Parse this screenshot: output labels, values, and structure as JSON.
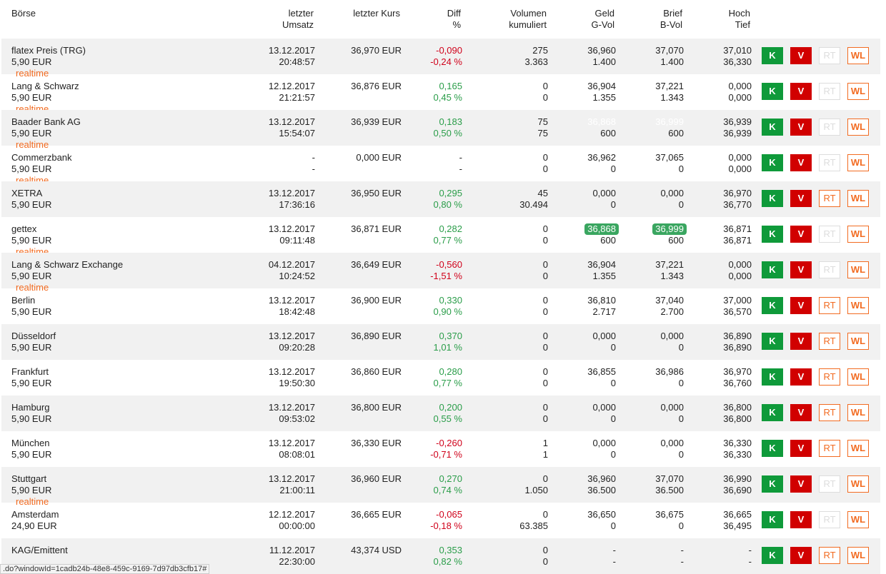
{
  "header": {
    "boerse": "Börse",
    "umsatz": [
      "letzter",
      "Umsatz"
    ],
    "kurs": "letzter Kurs",
    "diff": [
      "Diff",
      "%"
    ],
    "volumen": [
      "Volumen",
      "kumuliert"
    ],
    "geld": [
      "Geld",
      "G-Vol"
    ],
    "brief": [
      "Brief",
      "B-Vol"
    ],
    "hoch": [
      "Hoch",
      "Tief"
    ]
  },
  "buttons": {
    "k": "K",
    "v": "V",
    "rt": "RT",
    "wl": "WL"
  },
  "realtime_label": "realtime",
  "rows": [
    {
      "name": "flatex Preis (TRG)",
      "fee": "5,90 EUR",
      "realtime": true,
      "date": "13.12.2017",
      "time": "20:48:57",
      "kurs": "36,970 EUR",
      "diff": "-0,090",
      "pct": "-0,24 %",
      "dir": "neg",
      "vol": "275",
      "volk": "3.363",
      "geld": "36,960",
      "gvol": "1.400",
      "brief": "37,070",
      "bvol": "1.400",
      "hoch": "37,010",
      "tief": "36,330",
      "rt_active": false
    },
    {
      "name": "Lang & Schwarz",
      "fee": "5,90 EUR",
      "realtime": true,
      "date": "12.12.2017",
      "time": "21:21:57",
      "kurs": "36,876 EUR",
      "diff": "0,165",
      "pct": "0,45 %",
      "dir": "pos",
      "vol": "0",
      "volk": "0",
      "geld": "36,904",
      "gvol": "1.355",
      "brief": "37,221",
      "bvol": "1.343",
      "hoch": "0,000",
      "tief": "0,000",
      "rt_active": false
    },
    {
      "name": "Baader Bank AG",
      "fee": "5,90 EUR",
      "realtime": true,
      "date": "13.12.2017",
      "time": "15:54:07",
      "kurs": "36,939 EUR",
      "diff": "0,183",
      "pct": "0,50 %",
      "dir": "pos",
      "vol": "75",
      "volk": "75",
      "geld": "36,868",
      "gvol": "600",
      "brief": "36,999",
      "bvol": "600",
      "hoch": "36,939",
      "tief": "36,939",
      "rt_active": false,
      "quote_style": "faded"
    },
    {
      "name": "Commerzbank",
      "fee": "5,90 EUR",
      "realtime": true,
      "date": "-",
      "time": "-",
      "kurs": "0,000 EUR",
      "diff": "-",
      "pct": "-",
      "dir": "",
      "vol": "0",
      "volk": "0",
      "geld": "36,962",
      "gvol": "0",
      "brief": "37,065",
      "bvol": "0",
      "hoch": "0,000",
      "tief": "0,000",
      "rt_active": false
    },
    {
      "name": "XETRA",
      "fee": "5,90 EUR",
      "realtime": false,
      "date": "13.12.2017",
      "time": "17:36:16",
      "kurs": "36,950 EUR",
      "diff": "0,295",
      "pct": "0,80 %",
      "dir": "pos",
      "vol": "45",
      "volk": "30.494",
      "geld": "0,000",
      "gvol": "0",
      "brief": "0,000",
      "bvol": "0",
      "hoch": "36,970",
      "tief": "36,770",
      "rt_active": true
    },
    {
      "name": "gettex",
      "fee": "5,90 EUR",
      "realtime": true,
      "date": "13.12.2017",
      "time": "09:11:48",
      "kurs": "36,871 EUR",
      "diff": "0,282",
      "pct": "0,77 %",
      "dir": "pos",
      "vol": "0",
      "volk": "0",
      "geld": "36,868",
      "gvol": "600",
      "brief": "36,999",
      "bvol": "600",
      "hoch": "36,871",
      "tief": "36,871",
      "rt_active": false,
      "quote_style": "badge"
    },
    {
      "name": "Lang & Schwarz Exchange",
      "fee": "5,90 EUR",
      "realtime": true,
      "date": "04.12.2017",
      "time": "10:24:52",
      "kurs": "36,649 EUR",
      "diff": "-0,560",
      "pct": "-1,51 %",
      "dir": "neg",
      "vol": "0",
      "volk": "0",
      "geld": "36,904",
      "gvol": "1.355",
      "brief": "37,221",
      "bvol": "1.343",
      "hoch": "0,000",
      "tief": "0,000",
      "rt_active": false
    },
    {
      "name": "Berlin",
      "fee": "5,90 EUR",
      "realtime": false,
      "date": "13.12.2017",
      "time": "18:42:48",
      "kurs": "36,900 EUR",
      "diff": "0,330",
      "pct": "0,90 %",
      "dir": "pos",
      "vol": "0",
      "volk": "0",
      "geld": "36,810",
      "gvol": "2.717",
      "brief": "37,040",
      "bvol": "2.700",
      "hoch": "37,000",
      "tief": "36,570",
      "rt_active": true
    },
    {
      "name": "Düsseldorf",
      "fee": "5,90 EUR",
      "realtime": false,
      "date": "13.12.2017",
      "time": "09:20:28",
      "kurs": "36,890 EUR",
      "diff": "0,370",
      "pct": "1,01 %",
      "dir": "pos",
      "vol": "0",
      "volk": "0",
      "geld": "0,000",
      "gvol": "0",
      "brief": "0,000",
      "bvol": "0",
      "hoch": "36,890",
      "tief": "36,890",
      "rt_active": true
    },
    {
      "name": "Frankfurt",
      "fee": "5,90 EUR",
      "realtime": false,
      "date": "13.12.2017",
      "time": "19:50:30",
      "kurs": "36,860 EUR",
      "diff": "0,280",
      "pct": "0,77 %",
      "dir": "pos",
      "vol": "0",
      "volk": "0",
      "geld": "36,855",
      "gvol": "0",
      "brief": "36,986",
      "bvol": "0",
      "hoch": "36,970",
      "tief": "36,760",
      "rt_active": true
    },
    {
      "name": "Hamburg",
      "fee": "5,90 EUR",
      "realtime": false,
      "date": "13.12.2017",
      "time": "09:53:02",
      "kurs": "36,800 EUR",
      "diff": "0,200",
      "pct": "0,55 %",
      "dir": "pos",
      "vol": "0",
      "volk": "0",
      "geld": "0,000",
      "gvol": "0",
      "brief": "0,000",
      "bvol": "0",
      "hoch": "36,800",
      "tief": "36,800",
      "rt_active": true
    },
    {
      "name": "München",
      "fee": "5,90 EUR",
      "realtime": false,
      "date": "13.12.2017",
      "time": "08:08:01",
      "kurs": "36,330 EUR",
      "diff": "-0,260",
      "pct": "-0,71 %",
      "dir": "neg",
      "vol": "1",
      "volk": "1",
      "geld": "0,000",
      "gvol": "0",
      "brief": "0,000",
      "bvol": "0",
      "hoch": "36,330",
      "tief": "36,330",
      "rt_active": true
    },
    {
      "name": "Stuttgart",
      "fee": "5,90 EUR",
      "realtime": true,
      "date": "13.12.2017",
      "time": "21:00:11",
      "kurs": "36,960 EUR",
      "diff": "0,270",
      "pct": "0,74 %",
      "dir": "pos",
      "vol": "0",
      "volk": "1.050",
      "geld": "36,960",
      "gvol": "36.500",
      "brief": "37,070",
      "bvol": "36.500",
      "hoch": "36,990",
      "tief": "36,690",
      "rt_active": false
    },
    {
      "name": "Amsterdam",
      "fee": "24,90 EUR",
      "realtime": false,
      "date": "12.12.2017",
      "time": "00:00:00",
      "kurs": "36,665 EUR",
      "diff": "-0,065",
      "pct": "-0,18 %",
      "dir": "neg",
      "vol": "0",
      "volk": "63.385",
      "geld": "36,650",
      "gvol": "0",
      "brief": "36,675",
      "bvol": "0",
      "hoch": "36,665",
      "tief": "36,495",
      "rt_active": false
    },
    {
      "name": "KAG/Emittent",
      "fee": "",
      "realtime": false,
      "date": "11.12.2017",
      "time": "22:30:00",
      "kurs": "43,374 USD",
      "diff": "0,353",
      "pct": "0,82 %",
      "dir": "pos",
      "vol": "0",
      "volk": "0",
      "geld": "-",
      "gvol": "-",
      "brief": "-",
      "bvol": "-",
      "hoch": "-",
      "tief": "-",
      "rt_active": true
    }
  ],
  "status_url": ".do?windowId=1cadb24b-48e8-459c-9169-7d97db3cfb17#",
  "colors": {
    "buy": "#0f9a3a",
    "sell": "#d10000",
    "accent": "#f26b21",
    "pos": "#2a9d49",
    "neg": "#d0021b"
  }
}
